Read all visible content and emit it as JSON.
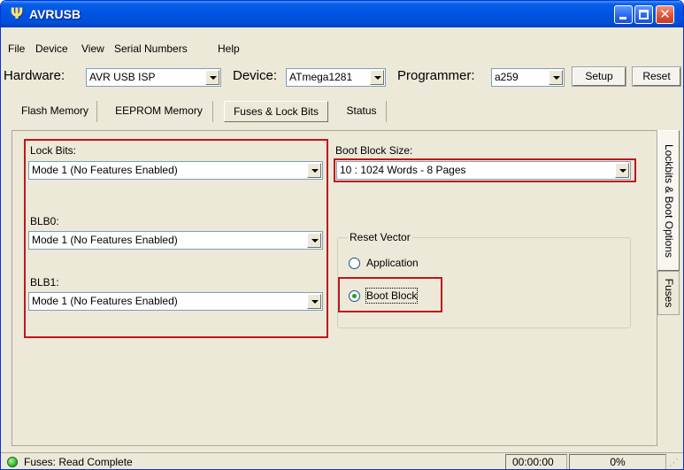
{
  "window": {
    "title": "AVRUSB",
    "icon": "usb-icon",
    "controls": [
      "minimize-icon",
      "maximize-icon",
      "close-icon"
    ],
    "close_glyph": "✕"
  },
  "menu": {
    "items": [
      "File",
      "Device",
      "View",
      "Serial Numbers",
      "Help"
    ]
  },
  "toolbar": {
    "hardware_label": "Hardware:",
    "hardware_value": "AVR USB ISP",
    "device_label": "Device:",
    "device_value": "ATmega1281",
    "programmer_label": "Programmer:",
    "programmer_value": "a259",
    "setup_label": "Setup",
    "reset_label": "Reset"
  },
  "tabs": {
    "items": [
      "Flash Memory",
      "EEPROM Memory",
      "Fuses & Lock Bits",
      "Status"
    ],
    "active": "Fuses & Lock Bits"
  },
  "lock_bits": {
    "lock_bits_label": "Lock Bits:",
    "lock_bits_value": "Mode 1 (No Features Enabled)",
    "blb0_label": "BLB0:",
    "blb0_value": "Mode 1 (No Features Enabled)",
    "blb1_label": "BLB1:",
    "blb1_value": "Mode 1 (No Features Enabled)"
  },
  "boot": {
    "boot_block_size_label": "Boot Block Size:",
    "boot_block_size_value": "10 : 1024 Words - 8 Pages",
    "reset_vector_label": "Reset Vector",
    "application_label": "Application",
    "boot_block_label": "Boot Block",
    "selected": "Boot Block"
  },
  "side_tabs": {
    "items": [
      "Lockbits & Boot Options",
      "Fuses"
    ],
    "active": "Lockbits & Boot Options"
  },
  "status": {
    "message": "Fuses: Read Complete",
    "time": "00:00:00",
    "progress": "0%",
    "progress_fraction": 0
  },
  "colors": {
    "title_bar": "#0054e3",
    "highlight_box": "#c0161c",
    "status_ok": "#3fc23a"
  }
}
